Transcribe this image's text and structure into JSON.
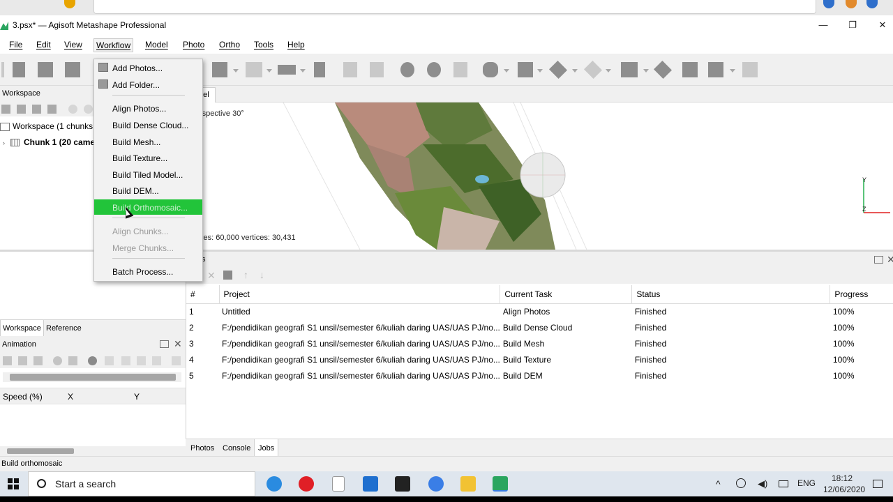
{
  "app": {
    "title": "3.psx* — Agisoft Metashape Professional",
    "window_controls": {
      "minimize": "—",
      "maximize": "❐",
      "close": "✕"
    }
  },
  "menubar": [
    "File",
    "Edit",
    "View",
    "Workflow",
    "Model",
    "Photo",
    "Ortho",
    "Tools",
    "Help"
  ],
  "workflow_menu": {
    "items": [
      {
        "label": "Add Photos...",
        "icon": "add-photos-icon"
      },
      {
        "label": "Add Folder...",
        "icon": "add-folder-icon"
      },
      {
        "label": "Align Photos..."
      },
      {
        "label": "Build Dense Cloud..."
      },
      {
        "label": "Build Mesh..."
      },
      {
        "label": "Build Texture..."
      },
      {
        "label": "Build Tiled Model..."
      },
      {
        "label": "Build DEM..."
      },
      {
        "label": "Build Orthomosaic...",
        "highlighted": true
      },
      {
        "label": "Align Chunks...",
        "disabled": true
      },
      {
        "label": "Merge Chunks...",
        "disabled": true
      },
      {
        "label": "Batch Process..."
      }
    ]
  },
  "workspace": {
    "header": "Workspace",
    "root": "Workspace (1 chunks, 2",
    "chunk": "Chunk 1 (20 came"
  },
  "viewport": {
    "tab_label": "del",
    "projection": "rspective 30°",
    "stats": "ces: 60,000 vertices: 30,431",
    "axis_y": "Y",
    "axis_z": "Z",
    "colors": {
      "axis_green": "#22b14c",
      "axis_red": "#e02020"
    }
  },
  "left_tabs": {
    "workspace": "Workspace",
    "reference": "Reference"
  },
  "animation": {
    "title": "Animation",
    "columns": [
      "Speed (%)",
      "X",
      "Y"
    ]
  },
  "jobs": {
    "title_fragment": "s",
    "columns": [
      "#",
      "Project",
      "Current Task",
      "Status",
      "Progress"
    ],
    "rows": [
      {
        "num": "1",
        "project": "Untitled",
        "task": "Align Photos",
        "status": "Finished",
        "progress": "100%"
      },
      {
        "num": "2",
        "project": "F:/pendidikan geografi S1 unsil/semester 6/kuliah daring UAS/UAS PJ/no...",
        "task": "Build Dense Cloud",
        "status": "Finished",
        "progress": "100%"
      },
      {
        "num": "3",
        "project": "F:/pendidikan geografi S1 unsil/semester 6/kuliah daring UAS/UAS PJ/no...",
        "task": "Build Mesh",
        "status": "Finished",
        "progress": "100%"
      },
      {
        "num": "4",
        "project": "F:/pendidikan geografi S1 unsil/semester 6/kuliah daring UAS/UAS PJ/no...",
        "task": "Build Texture",
        "status": "Finished",
        "progress": "100%"
      },
      {
        "num": "5",
        "project": "F:/pendidikan geografi S1 unsil/semester 6/kuliah daring UAS/UAS PJ/no...",
        "task": "Build DEM",
        "status": "Finished",
        "progress": "100%"
      }
    ]
  },
  "bottom_tabs": [
    "Photos",
    "Console",
    "Jobs"
  ],
  "status_bar": "Build orthomosaic",
  "taskbar": {
    "search_placeholder": "Start a search",
    "language": "ENG",
    "time": "18:12",
    "date": "12/06/2020"
  },
  "accent": {
    "menu_highlight": "#22c43a"
  }
}
